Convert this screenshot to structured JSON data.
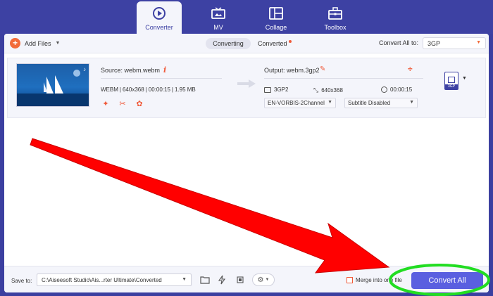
{
  "nav": {
    "tabs": [
      {
        "label": "Converter",
        "icon": "converter-icon",
        "active": true
      },
      {
        "label": "MV",
        "icon": "tv-icon",
        "active": false
      },
      {
        "label": "Collage",
        "icon": "collage-icon",
        "active": false
      },
      {
        "label": "Toolbox",
        "icon": "toolbox-icon",
        "active": false
      }
    ]
  },
  "toolbar": {
    "add_files": "Add Files",
    "converting": "Converting",
    "converted": "Converted",
    "convert_all_to": "Convert All to:",
    "format": "3GP"
  },
  "file": {
    "source": "Source: webm.webm",
    "format": "WEBM",
    "resolution": "640x368",
    "duration": "00:00:15",
    "size": "1.95 MB",
    "output": "Output: webm.3gp2",
    "out_format": "3GP2",
    "out_resolution": "640x368",
    "out_duration": "00:00:15",
    "audio_track": "EN-VORBIS-2Channel",
    "subtitle": "Subtitle Disabled",
    "format_badge": "3GP"
  },
  "bottom": {
    "save_to": "Save to:",
    "path": "C:\\Aiseesoft Studio\\Ais...rter Ultimate\\Converted",
    "merge": "Merge into one file",
    "convert_all": "Convert All"
  },
  "colors": {
    "brand": "#3d41a3",
    "accent": "#f26b3a",
    "button": "#5a5fe0",
    "arrow_annotation": "#ff0000",
    "highlight_annotation": "#22dd22"
  }
}
